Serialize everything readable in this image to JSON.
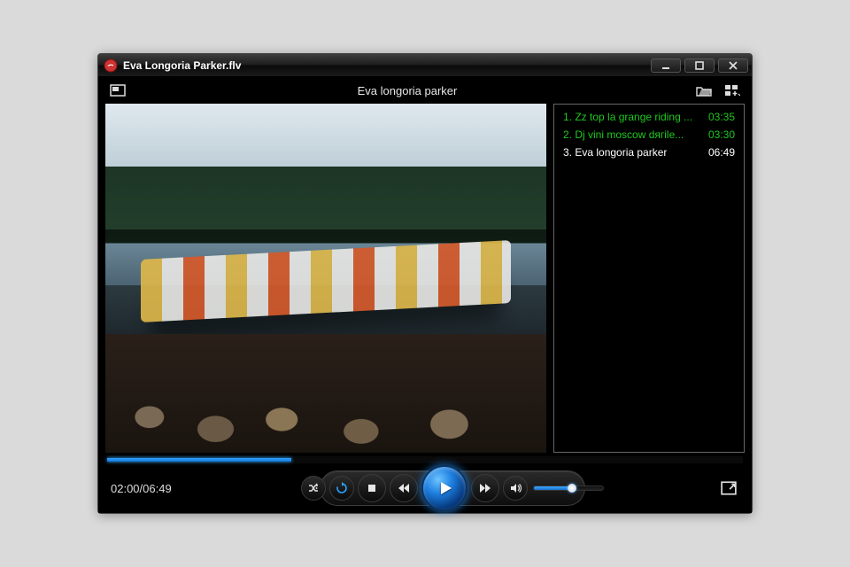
{
  "window": {
    "title": "Eva Longoria Parker.flv"
  },
  "subbar": {
    "now_playing": "Eva longoria parker"
  },
  "playlist": [
    {
      "index": "1.",
      "title": "Zz top la grange riding ...",
      "duration": "03:35",
      "active": true
    },
    {
      "index": "2.",
      "title": "Dj vini moscow dягile...",
      "duration": "03:30",
      "active": true
    },
    {
      "index": "3.",
      "title": "Eva longoria parker",
      "duration": "06:49",
      "active": false
    }
  ],
  "playback": {
    "current_display": "02:00/06:49",
    "current_seconds": 120,
    "total_seconds": 409,
    "progress_pct": 29
  },
  "volume": {
    "pct": 55
  },
  "colors": {
    "accent": "#1e7fe0",
    "playlist_active": "#1ec91e"
  }
}
